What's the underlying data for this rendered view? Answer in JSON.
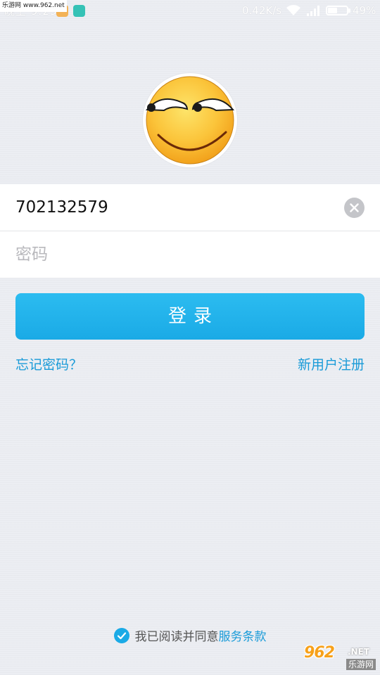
{
  "status_bar": {
    "time": "晚上 9:23",
    "net_speed": "0.42K/s",
    "battery_level": 0.49,
    "battery_text": "49%",
    "icons": [
      "app-notification-icon",
      "cloud-app-icon",
      "wifi-icon",
      "signal-icon",
      "battery-icon"
    ]
  },
  "watermark_top": "乐游网 www.962.net",
  "avatar": {
    "icon": "grinning-face-avatar"
  },
  "login_form": {
    "account_value": "702132579",
    "password_placeholder": "密码",
    "clear_icon": "clear-icon"
  },
  "login_button": {
    "label": "登录"
  },
  "links": {
    "forgot_password": "忘记密码？",
    "register": "新用户注册"
  },
  "agreement": {
    "text": "我已阅读并同意",
    "link": "服务条款",
    "checked": true
  },
  "watermark_bottom": {
    "logo": "962",
    "net": ".NET",
    "sub": "乐游网"
  },
  "colors": {
    "accent": "#1aaae6",
    "link": "#1a9bd8",
    "background": "#eceef3"
  }
}
